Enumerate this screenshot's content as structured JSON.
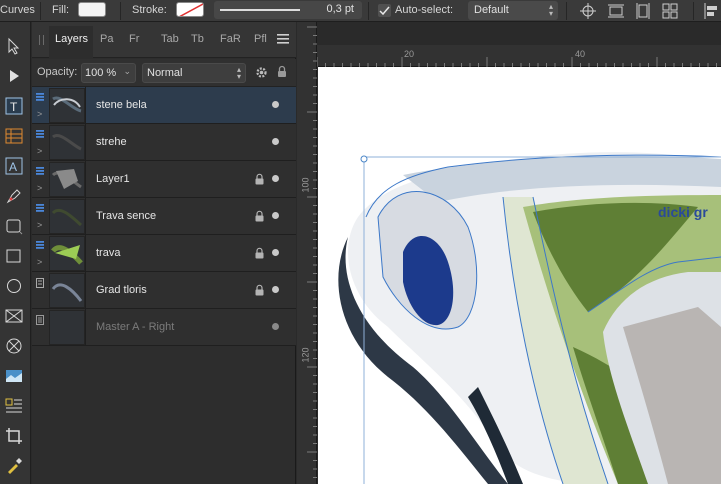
{
  "context_toolbar": {
    "mode_label": "Curves",
    "fill_label": "Fill:",
    "stroke_label": "Stroke:",
    "stroke_width": "0,3 pt",
    "auto_select_label": "Auto-select:",
    "auto_select_checked": true,
    "auto_select_value": "Default"
  },
  "layers_panel": {
    "tabs": [
      "Layers",
      "Pa",
      "Fr",
      "Tab",
      "Tb",
      "FaR",
      "Pfl"
    ],
    "active_tab": "Layers",
    "opacity_label": "Opacity:",
    "opacity_value": "100 %",
    "blend_mode": "Normal",
    "layers": [
      {
        "name": "stene bela",
        "selected": true,
        "locked": false,
        "dim": false
      },
      {
        "name": "strehe",
        "selected": false,
        "locked": false,
        "dim": false
      },
      {
        "name": "Layer1",
        "selected": false,
        "locked": true,
        "dim": false
      },
      {
        "name": "Trava sence",
        "selected": false,
        "locked": true,
        "dim": false
      },
      {
        "name": "trava",
        "selected": false,
        "locked": true,
        "dim": false
      },
      {
        "name": "Grad tloris",
        "selected": false,
        "locked": true,
        "dim": false
      },
      {
        "name": "Master A - Right",
        "selected": false,
        "locked": false,
        "dim": true
      }
    ]
  },
  "rulers": {
    "unit": "mm",
    "horizontal_labels": [
      "20",
      "40"
    ],
    "vertical_labels": [
      "100",
      "120"
    ]
  },
  "canvas": {
    "visible_text": "dicki gr"
  },
  "colors": {
    "selection": "#2d3c4d",
    "accent_blue": "#3c78c8",
    "grass": "#6a8a3a",
    "pale_grass": "#a7c07a"
  }
}
